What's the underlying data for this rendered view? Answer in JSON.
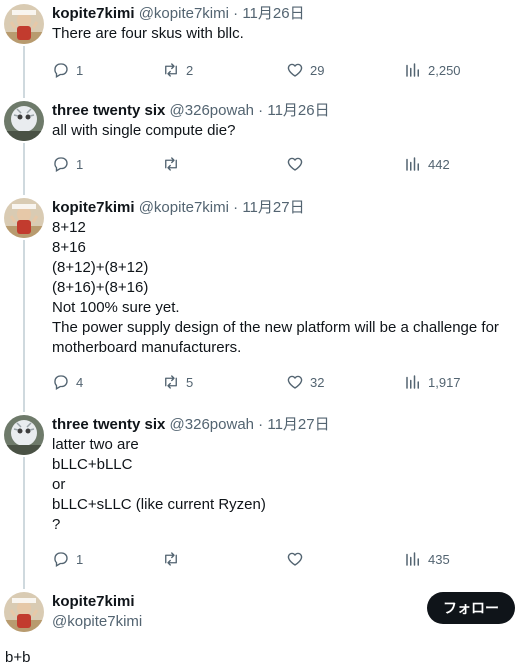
{
  "tweets": [
    {
      "name": "kopite7kimi",
      "handle": "@kopite7kimi",
      "sep": " · ",
      "time": "11月26日",
      "lines": [
        "There are four skus with bllc."
      ],
      "replies": "1",
      "retweets": "2",
      "likes": "29",
      "views": "2,250"
    },
    {
      "name": "three twenty six",
      "handle": "@326powah",
      "sep": " · ",
      "time": "11月26日",
      "lines": [
        "all with single compute die?"
      ],
      "replies": "1",
      "retweets": "",
      "likes": "",
      "views": "442"
    },
    {
      "name": "kopite7kimi",
      "handle": "@kopite7kimi",
      "sep": " · ",
      "time": "11月27日",
      "lines": [
        "8+12",
        "8+16",
        "(8+12)+(8+12)",
        "(8+16)+(8+16)",
        "Not 100% sure yet.",
        "The power supply design of the new platform will be a challenge for",
        "motherboard manufacturers."
      ],
      "replies": "4",
      "retweets": "5",
      "likes": "32",
      "views": "1,917"
    },
    {
      "name": "three twenty six",
      "handle": "@326powah",
      "sep": " · ",
      "time": "11月27日",
      "lines": [
        "latter two are",
        "bLLC+bLLC",
        "or",
        "bLLC+sLLC (like current Ryzen)",
        "?"
      ],
      "replies": "1",
      "retweets": "",
      "likes": "",
      "views": "435"
    }
  ],
  "main": {
    "name": "kopite7kimi",
    "handle": "@kopite7kimi",
    "follow_label": "フォロー",
    "text": "b+b"
  },
  "colors": {
    "text": "#0f1419",
    "muted": "#536471",
    "line": "#cfd9de",
    "button": "#0f1419"
  },
  "icons": [
    "reply-icon",
    "retweet-icon",
    "like-icon",
    "views-icon",
    "avatar-kopite7kimi",
    "avatar-326powah"
  ]
}
